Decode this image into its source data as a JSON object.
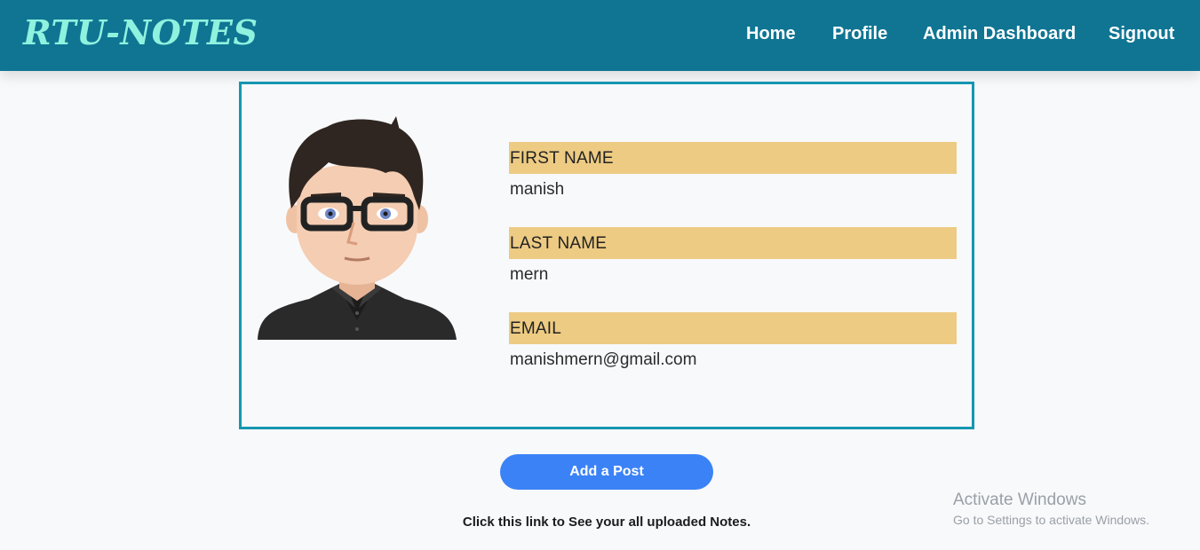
{
  "navbar": {
    "brand": "RTU-NOTES",
    "links": [
      "Home",
      "Profile",
      "Admin Dashboard",
      "Signout"
    ],
    "bg_color": "#0f7593",
    "brand_color": "#8ff2de"
  },
  "profile": {
    "avatar_icon": "cartoon-man-with-glasses",
    "fields": [
      {
        "label": "FIRST NAME",
        "value": "manish"
      },
      {
        "label": "LAST NAME",
        "value": "mern"
      },
      {
        "label": "EMAIL",
        "value": "manishmern@gmail.com"
      }
    ],
    "label_bg": "#edcb83",
    "border_color": "#1596b0"
  },
  "actions": {
    "add_post_label": "Add a Post",
    "notes_link_text": "Click this link to See your all uploaded Notes.",
    "button_color": "#3b82f6"
  },
  "watermark": {
    "title": "Activate Windows",
    "subtitle": "Go to Settings to activate Windows."
  }
}
